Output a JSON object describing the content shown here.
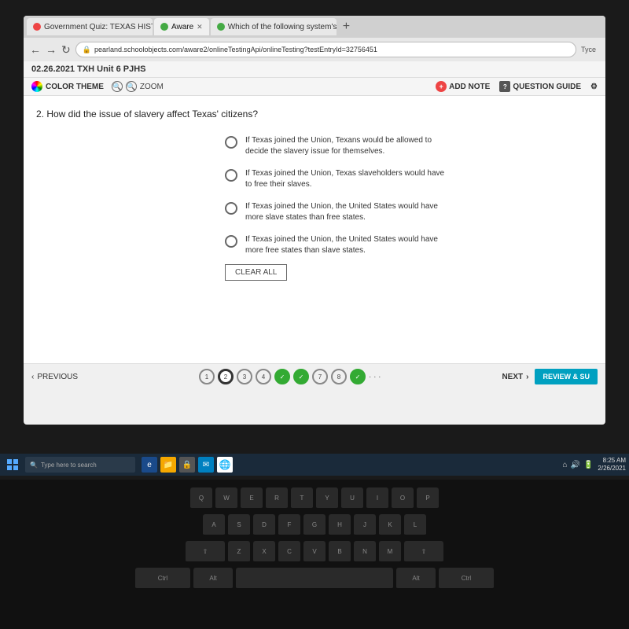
{
  "browser": {
    "tabs": [
      {
        "label": "Government Quiz: TEXAS HISTO",
        "active": false,
        "favicon": "red"
      },
      {
        "label": "Aware",
        "active": true,
        "favicon": "green"
      },
      {
        "label": "Which of the following system's",
        "active": false,
        "favicon": "green"
      }
    ],
    "url": "pearland.schoolobjects.com/aware2/onlineTestingApi/onlineTesting?testEntryId=32756451",
    "tyce_label": "Tyce"
  },
  "header": {
    "title": "02.26.2021 TXH Unit 6 PJHS"
  },
  "toolbar": {
    "color_theme_label": "COLOR THEME",
    "zoom_label": "ZOOM",
    "add_note_label": "ADD NOTE",
    "question_guide_label": "QUESTION GUIDE"
  },
  "question": {
    "number": "2",
    "text": "2. How did the issue of slavery affect Texas' citizens?",
    "answers": [
      {
        "id": "A",
        "text": "If Texas joined the Union, Texans would be allowed to decide the slavery issue for themselves."
      },
      {
        "id": "B",
        "text": "If Texas joined the Union, Texas slaveholders would have to free their slaves."
      },
      {
        "id": "C",
        "text": "If Texas joined the Union, the United States would have more slave states than free states."
      },
      {
        "id": "D",
        "text": "If Texas joined the Union, the United States would have more free states than slave states."
      }
    ],
    "clear_all_label": "CLEAR ALL"
  },
  "navigation": {
    "prev_label": "PREVIOUS",
    "next_label": "NEXT",
    "review_label": "REVIEW & SU",
    "dots": [
      {
        "num": "1",
        "state": "normal"
      },
      {
        "num": "2",
        "state": "active"
      },
      {
        "num": "3",
        "state": "normal"
      },
      {
        "num": "4",
        "state": "normal"
      },
      {
        "num": "5",
        "state": "completed"
      },
      {
        "num": "6",
        "state": "completed"
      },
      {
        "num": "7",
        "state": "normal"
      },
      {
        "num": "8",
        "state": "normal"
      },
      {
        "num": "9",
        "state": "completed"
      }
    ]
  },
  "taskbar": {
    "search_placeholder": "Type here to search",
    "clock_time": "8:25 AM",
    "clock_date": "2/26/2021"
  }
}
